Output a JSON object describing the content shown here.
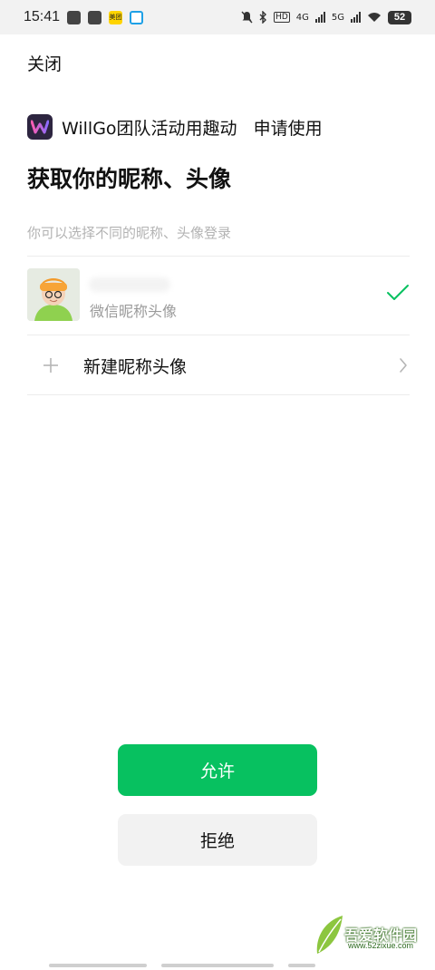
{
  "status_bar": {
    "time": "15:41",
    "app_icon_text": "美团",
    "network_4g": "4G",
    "network_5g": "5G",
    "battery": "52"
  },
  "header": {
    "close_label": "关闭"
  },
  "app": {
    "name": "WillGo团队活动用趣动",
    "action": "申请使用",
    "logo_letter": "W"
  },
  "page": {
    "title": "获取你的昵称、头像",
    "hint": "你可以选择不同的昵称、头像登录"
  },
  "options": {
    "wechat_label": "微信昵称头像",
    "new_label": "新建昵称头像"
  },
  "buttons": {
    "allow": "允许",
    "deny": "拒绝"
  },
  "watermark": {
    "text": "吾爱软件园",
    "url": "www.52zixue.com"
  },
  "colors": {
    "accent_green": "#07c160",
    "check_green": "#07c160"
  }
}
